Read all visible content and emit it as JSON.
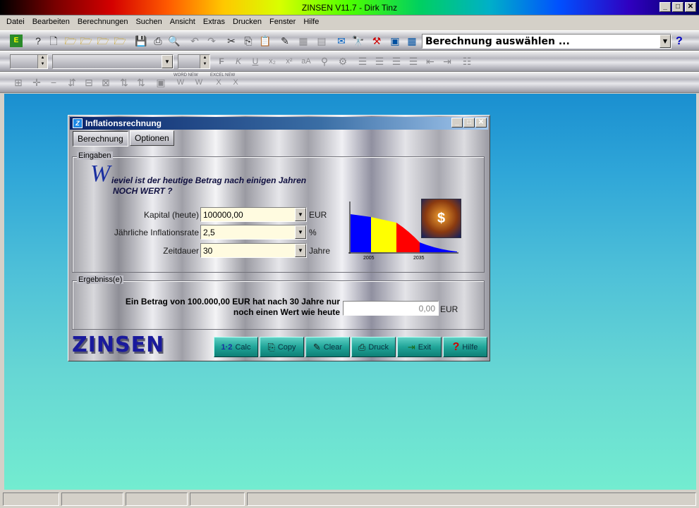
{
  "app": {
    "title": "ZINSEN V11.7 - Dirk Tinz",
    "menu": [
      "Datei",
      "Bearbeiten",
      "Berechnungen",
      "Suchen",
      "Ansicht",
      "Extras",
      "Drucken",
      "Fenster",
      "Hilfe"
    ],
    "calc_selector": "Berechnung auswählen ...",
    "help_icon_label": "?"
  },
  "toolbar3_labels": {
    "word_new": "WORD NEW",
    "excel_new": "EXCEL NEW"
  },
  "dialog": {
    "title": "Inflationsrechnung",
    "tabs": [
      "Berechnung",
      "Optionen"
    ],
    "inputs_group": "Eingaben",
    "headline_first_letter": "W",
    "headline_rest": "ieviel ist der heutige Betrag nach einigen Jahren",
    "headline_line2": "NOCH WERT ?",
    "fields": [
      {
        "label": "Kapital (heute)",
        "value": "100000,00",
        "unit": "EUR"
      },
      {
        "label": "Jährliche Inflationsrate",
        "value": "2,5",
        "unit": "%"
      },
      {
        "label": "Zeitdauer",
        "value": "30",
        "unit": "Jahre"
      }
    ],
    "chart": {
      "x_labels": [
        "2005",
        "2035"
      ],
      "colors": [
        "#0000ff",
        "#ffff00",
        "#ff0000",
        "#0000ff"
      ]
    },
    "result_group": "Ergebniss(e)",
    "result_line1": "Ein Betrag von 100.000,00 EUR hat nach 30 Jahre nur",
    "result_line2": "noch einen Wert wie heute",
    "result_value": "0,00",
    "result_unit": "EUR",
    "logo": "ZINSEN",
    "buttons": [
      {
        "label": "Calc",
        "icon": "1·2"
      },
      {
        "label": "Copy",
        "icon": "⎘"
      },
      {
        "label": "Clear",
        "icon": "✎"
      },
      {
        "label": "Druck",
        "icon": "⎙"
      },
      {
        "label": "Exit",
        "icon": "⇥"
      },
      {
        "label": "Hilfe",
        "icon": "?"
      }
    ]
  }
}
